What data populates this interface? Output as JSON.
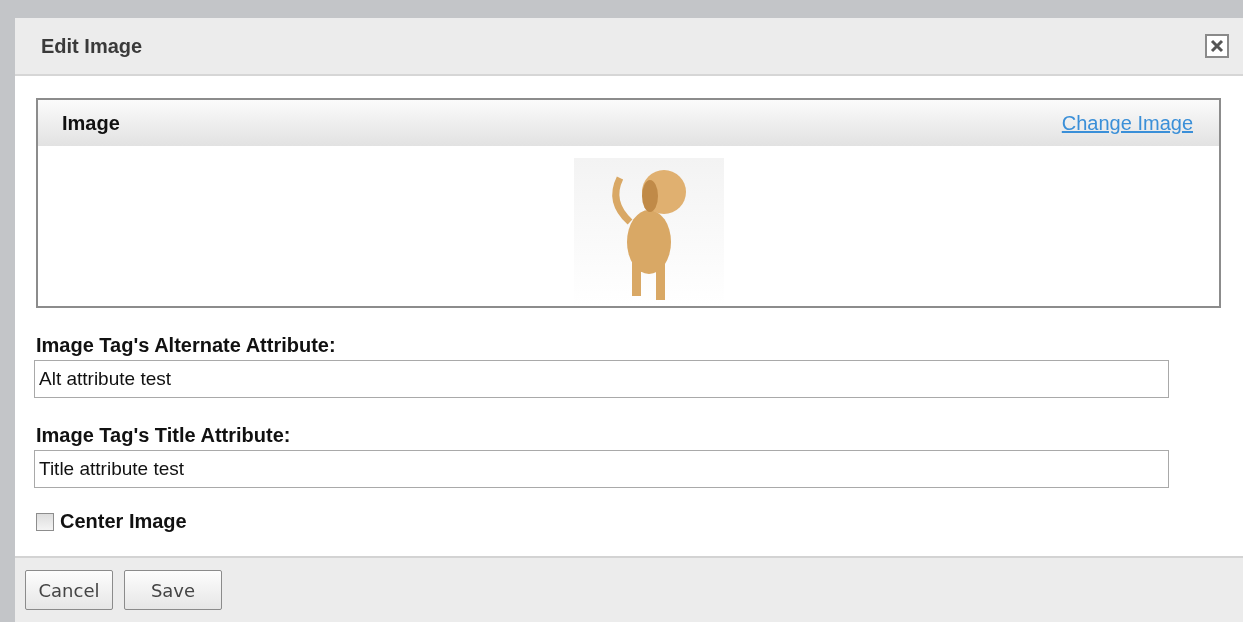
{
  "dialog": {
    "title": "Edit Image"
  },
  "image_panel": {
    "title": "Image",
    "link": "Change Image"
  },
  "fields": [
    {
      "label": "Image Tag's Alternate Attribute:",
      "value": "Alt attribute test"
    },
    {
      "label": "Image Tag's Title Attribute:",
      "value": "Title attribute test"
    }
  ],
  "center_image": {
    "label": "Center Image",
    "checked": false
  },
  "buttons": [
    "Cancel",
    "Save"
  ]
}
